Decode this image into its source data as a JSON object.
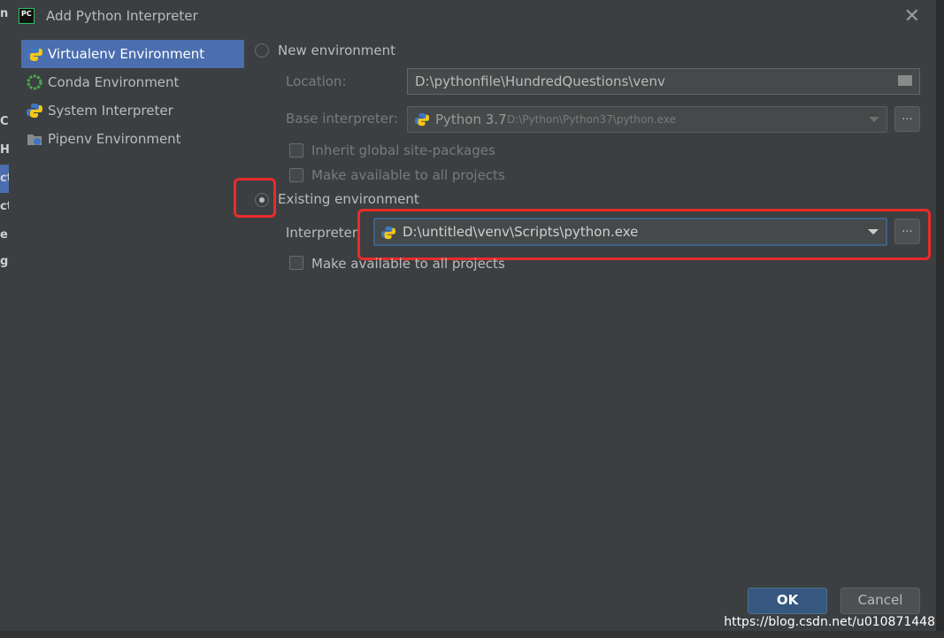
{
  "background_strip": {
    "letters": [
      "n",
      "C",
      "H",
      "ct",
      "ct",
      "e",
      "ge"
    ]
  },
  "dialog": {
    "title": "Add Python Interpreter",
    "close_label": "✕"
  },
  "sidebar": {
    "items": [
      {
        "label": "Virtualenv Environment",
        "icon": "python-virtualenv-icon",
        "active": true
      },
      {
        "label": "Conda Environment",
        "icon": "conda-icon",
        "active": false
      },
      {
        "label": "System Interpreter",
        "icon": "python-icon",
        "active": false
      },
      {
        "label": "Pipenv Environment",
        "icon": "pipenv-icon",
        "active": false
      }
    ]
  },
  "new_env": {
    "radio_label": "New environment",
    "selected": false,
    "location_label": "Location:",
    "location_value": "D:\\pythonfile\\HundredQuestions\\venv",
    "base_label": "Base interpreter:",
    "base_version": "Python 3.7",
    "base_path": "D:\\Python\\Python37\\python.exe",
    "browse_label": "...",
    "inherit_label": "Inherit global site-packages",
    "make_available_label": "Make available to all projects"
  },
  "existing_env": {
    "radio_label": "Existing environment",
    "selected": true,
    "interpreter_label": "Interpreter",
    "interpreter_value": "D:\\untitled\\venv\\Scripts\\python.exe",
    "browse_label": "...",
    "make_available_label": "Make available to all projects"
  },
  "footer": {
    "ok_label": "OK",
    "cancel_label": "Cancel"
  },
  "watermark": "https://blog.csdn.net/u010871448",
  "colors": {
    "background": "#3c3f41",
    "selection": "#4b6eaf",
    "highlight": "#ea2b2b",
    "ok_button": "#365880"
  }
}
